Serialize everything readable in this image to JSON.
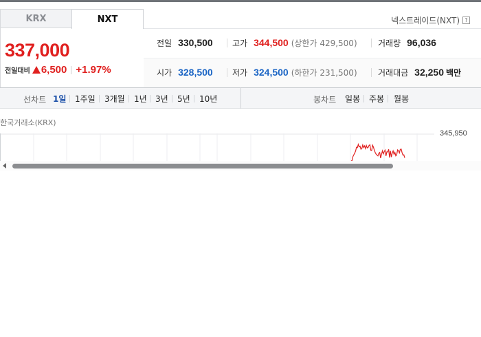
{
  "tabs": [
    {
      "label": "KRX",
      "active": false
    },
    {
      "label": "NXT",
      "active": true
    }
  ],
  "exchange": {
    "label": "넥스트레이드(NXT)",
    "help": "?"
  },
  "quote": {
    "price": "337,000",
    "change_label": "전일대비",
    "change_amount": "6,500",
    "change_percent": "+1.97%"
  },
  "stats": {
    "prev_close": {
      "label": "전일",
      "value": "330,500"
    },
    "high": {
      "label": "고가",
      "value": "344,500",
      "limit_text": "(상한가 429,500)"
    },
    "volume": {
      "label": "거래량",
      "value": "96,036"
    },
    "open": {
      "label": "시가",
      "value": "328,500"
    },
    "low": {
      "label": "저가",
      "value": "324,500",
      "limit_text": "(하한가 231,500)"
    },
    "amount": {
      "label": "거래대금",
      "value": "32,250",
      "unit": "백만"
    }
  },
  "line_chart_label": "선차트",
  "periods": [
    "1일",
    "1주일",
    "3개월",
    "1년",
    "3년",
    "5년",
    "10년"
  ],
  "active_period": "1일",
  "candle_chart_label": "봉차트",
  "candle_periods": [
    "일봉",
    "주봉",
    "월봉"
  ],
  "chart": {
    "source": "한국거래소(KRX)",
    "y_max_label": "345,950",
    "line_color": "#e0201f"
  }
}
